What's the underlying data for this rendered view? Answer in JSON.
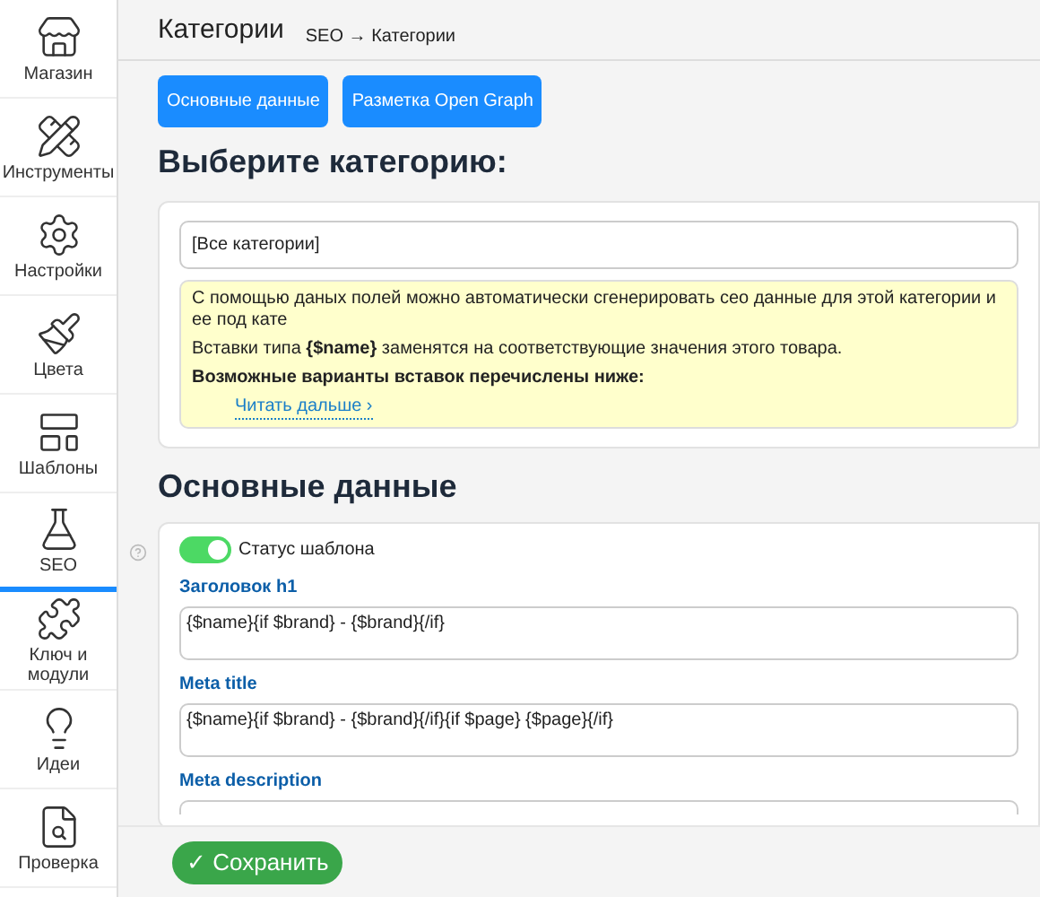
{
  "sidebar": {
    "items": [
      {
        "label": "Магазин",
        "selected": false
      },
      {
        "label": "Инструменты",
        "selected": false
      },
      {
        "label": "Настройки",
        "selected": false
      },
      {
        "label": "Цвета",
        "selected": false
      },
      {
        "label": "Шаблоны",
        "selected": false
      },
      {
        "label": "SEO",
        "selected": true
      },
      {
        "label": "Ключ и модули",
        "selected": false
      },
      {
        "label": "Идеи",
        "selected": false
      },
      {
        "label": "Проверка",
        "selected": false
      }
    ]
  },
  "header": {
    "title": "Категории",
    "breadcrumb": "SEO → Категории"
  },
  "tabs": [
    {
      "label": "Основные данные"
    },
    {
      "label": "Разметка Open Graph"
    }
  ],
  "category_section": {
    "heading": "Выберите категорию:",
    "select_value": "[Все категории]",
    "note": {
      "lines": [
        "С помощью даных полей можно автоматически сгенерировать сео данные для этой категории и ее под кате",
        "Вставки типа **{$name}** заменятся на соответствующие значения этого товара.",
        "**Возможные варианты вставок перечислены ниже:**"
      ],
      "link": "Читать дальше ›"
    }
  },
  "main_section": {
    "heading": "Основные данные",
    "toggle": {
      "label": "Статус шаблона",
      "on": true
    },
    "fields": [
      {
        "label": "Заголовок h1",
        "value": "{$name}{if $brand} - {$brand}{/if}"
      },
      {
        "label": "Meta title",
        "value": "{$name}{if $brand} - {$brand}{/if}{if $page} {$page}{/if}"
      },
      {
        "label": "Meta description"
      }
    ]
  },
  "save_button": {
    "label": "✓ Сохранить"
  }
}
